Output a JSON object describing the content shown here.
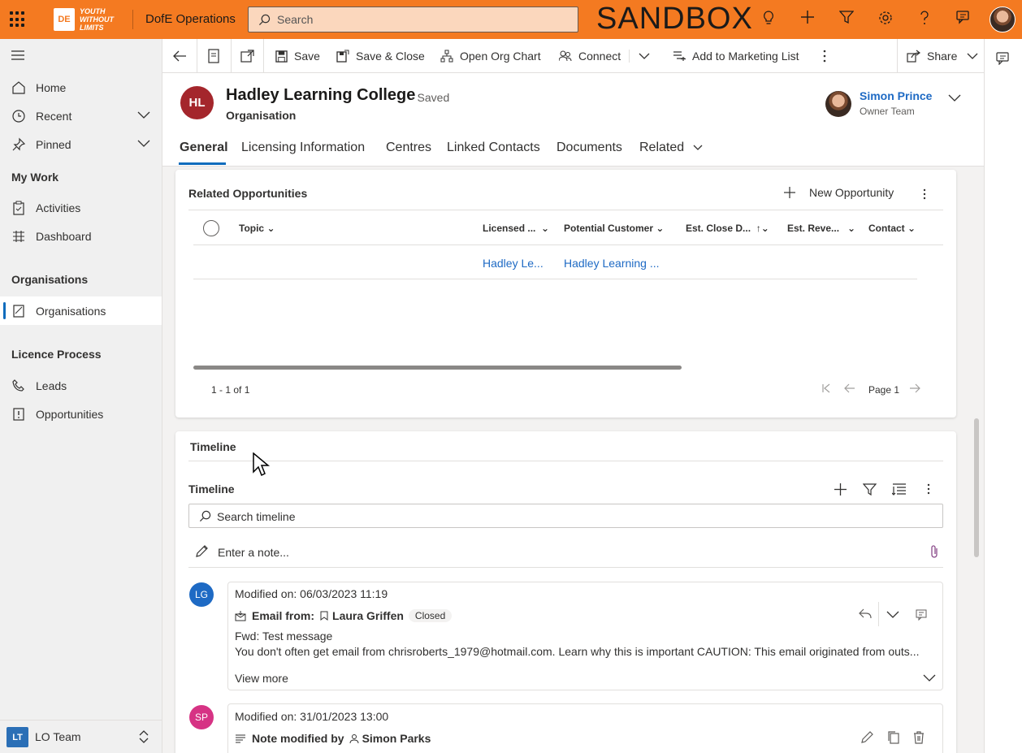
{
  "topbar": {
    "logo_mark": "DE",
    "logo_text": "YOUTH WITHOUT LIMITS",
    "app_name": "DofE Operations",
    "search_placeholder": "Search",
    "environment": "SANDBOX",
    "bg_color": "#f47a21"
  },
  "nav": {
    "home": "Home",
    "recent": "Recent",
    "pinned": "Pinned",
    "my_work": "My Work",
    "activities": "Activities",
    "dashboard": "Dashboard",
    "organisations_section": "Organisations",
    "organisations": "Organisations",
    "licence_section": "Licence Process",
    "leads": "Leads",
    "opportunities": "Opportunities",
    "team_badge": "LT",
    "team_label": "LO Team"
  },
  "commands": {
    "save": "Save",
    "save_close": "Save & Close",
    "org_chart": "Open Org Chart",
    "connect": "Connect",
    "marketing": "Add to Marketing List",
    "share": "Share"
  },
  "record": {
    "initials": "HL",
    "title": "Hadley Learning College",
    "status": "- Saved",
    "type": "Organisation",
    "owner_name": "Simon Prince",
    "owner_role": "Owner Team",
    "badge_color": "#a4262c"
  },
  "tabs": [
    "General",
    "Licensing Information",
    "Centres",
    "Linked Contacts",
    "Documents",
    "Related"
  ],
  "opportunities": {
    "title": "Related Opportunities",
    "new_label": "New Opportunity",
    "columns": [
      "Topic",
      "Licensed ...",
      "Potential Customer",
      "Est. Close D...",
      "Est. Reve...",
      "Contact"
    ],
    "rows": [
      {
        "topic": "",
        "licensed": "Hadley Le...",
        "customer": "Hadley Learning ...",
        "close": "",
        "revenue": "",
        "contact": ""
      }
    ],
    "count_text": "1 - 1 of 1",
    "page_text": "Page 1"
  },
  "timeline": {
    "section_title": "Timeline",
    "inner_title": "Timeline",
    "search_placeholder": "Search timeline",
    "note_placeholder": "Enter a note...",
    "posts": [
      {
        "initials": "LG",
        "color": "#1e6ac4",
        "modified": "Modified on: 06/03/2023 11:19",
        "kind": "Email from:",
        "person": "Laura Griffen",
        "badge": "Closed",
        "subject": "Fwd: Test message",
        "body": "You don't often get email from chrisroberts_1979@hotmail.com. Learn why this is important CAUTION: This email originated from outs...",
        "view_more": "View more"
      },
      {
        "initials": "SP",
        "color": "#d63384",
        "modified": "Modified on: 31/01/2023 13:00",
        "kind": "Note modified by",
        "person": "Simon Parks"
      }
    ]
  }
}
